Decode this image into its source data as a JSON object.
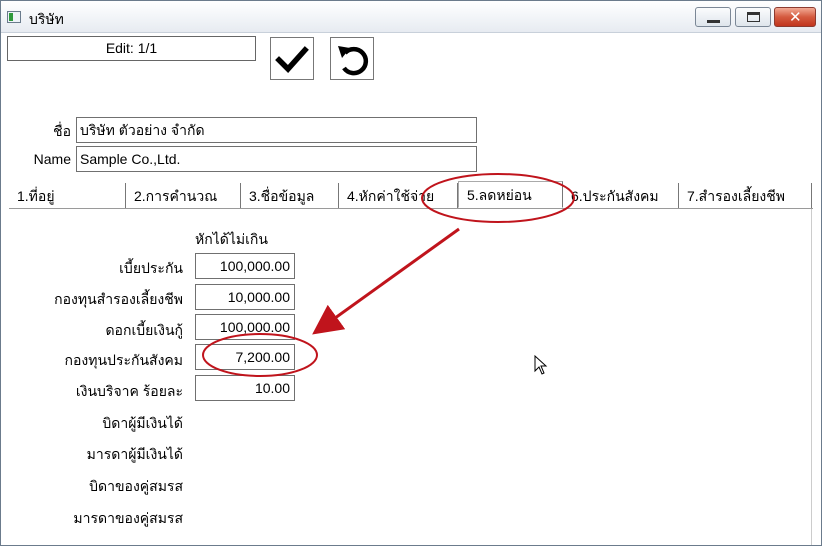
{
  "window": {
    "title": "บริษัท",
    "icon": "app-window-icon"
  },
  "caption_buttons": {
    "minimize": "minimize-icon",
    "maximize": "maximize-icon",
    "close": "close-icon"
  },
  "toolbar": {
    "record_status": "Edit: 1/1",
    "ok_icon": "checkmark-icon",
    "undo_icon": "undo-icon"
  },
  "company": {
    "name_th_label": "ชื่อ",
    "name_th_value": "บริษัท ตัวอย่าง จำกัด",
    "name_en_label": "Name",
    "name_en_value": "Sample Co.,Ltd."
  },
  "tabs": [
    {
      "label": "1.ที่อยู่"
    },
    {
      "label": "2.การคำนวณ"
    },
    {
      "label": "3.ชื่อข้อมูล"
    },
    {
      "label": "4.หักค่าใช้จ่าย"
    },
    {
      "label": "5.ลดหย่อน",
      "active": true
    },
    {
      "label": "6.ประกันสังคม"
    },
    {
      "label": "7.สำรองเลี้ยงชีพ"
    }
  ],
  "deductions": {
    "column_header": "หักได้ไม่เกิน",
    "rows": [
      {
        "label": "เบี้ยประกัน",
        "value": "100,000.00"
      },
      {
        "label": "กองทุนสำรองเลี้ยงชีพ",
        "value": "10,000.00"
      },
      {
        "label": "ดอกเบี้ยเงินกู้",
        "value": "100,000.00"
      },
      {
        "label": "กองทุนประกันสังคม",
        "value": "7,200.00"
      },
      {
        "label": "เงินบริจาค ร้อยละ",
        "value": "10.00"
      }
    ],
    "extra_labels": [
      "บิดาผู้มีเงินได้",
      "มารดาผู้มีเงินได้",
      "บิดาของคู่สมรส",
      "มารดาของคู่สมรส"
    ]
  },
  "annotation_color": "#c0141c"
}
